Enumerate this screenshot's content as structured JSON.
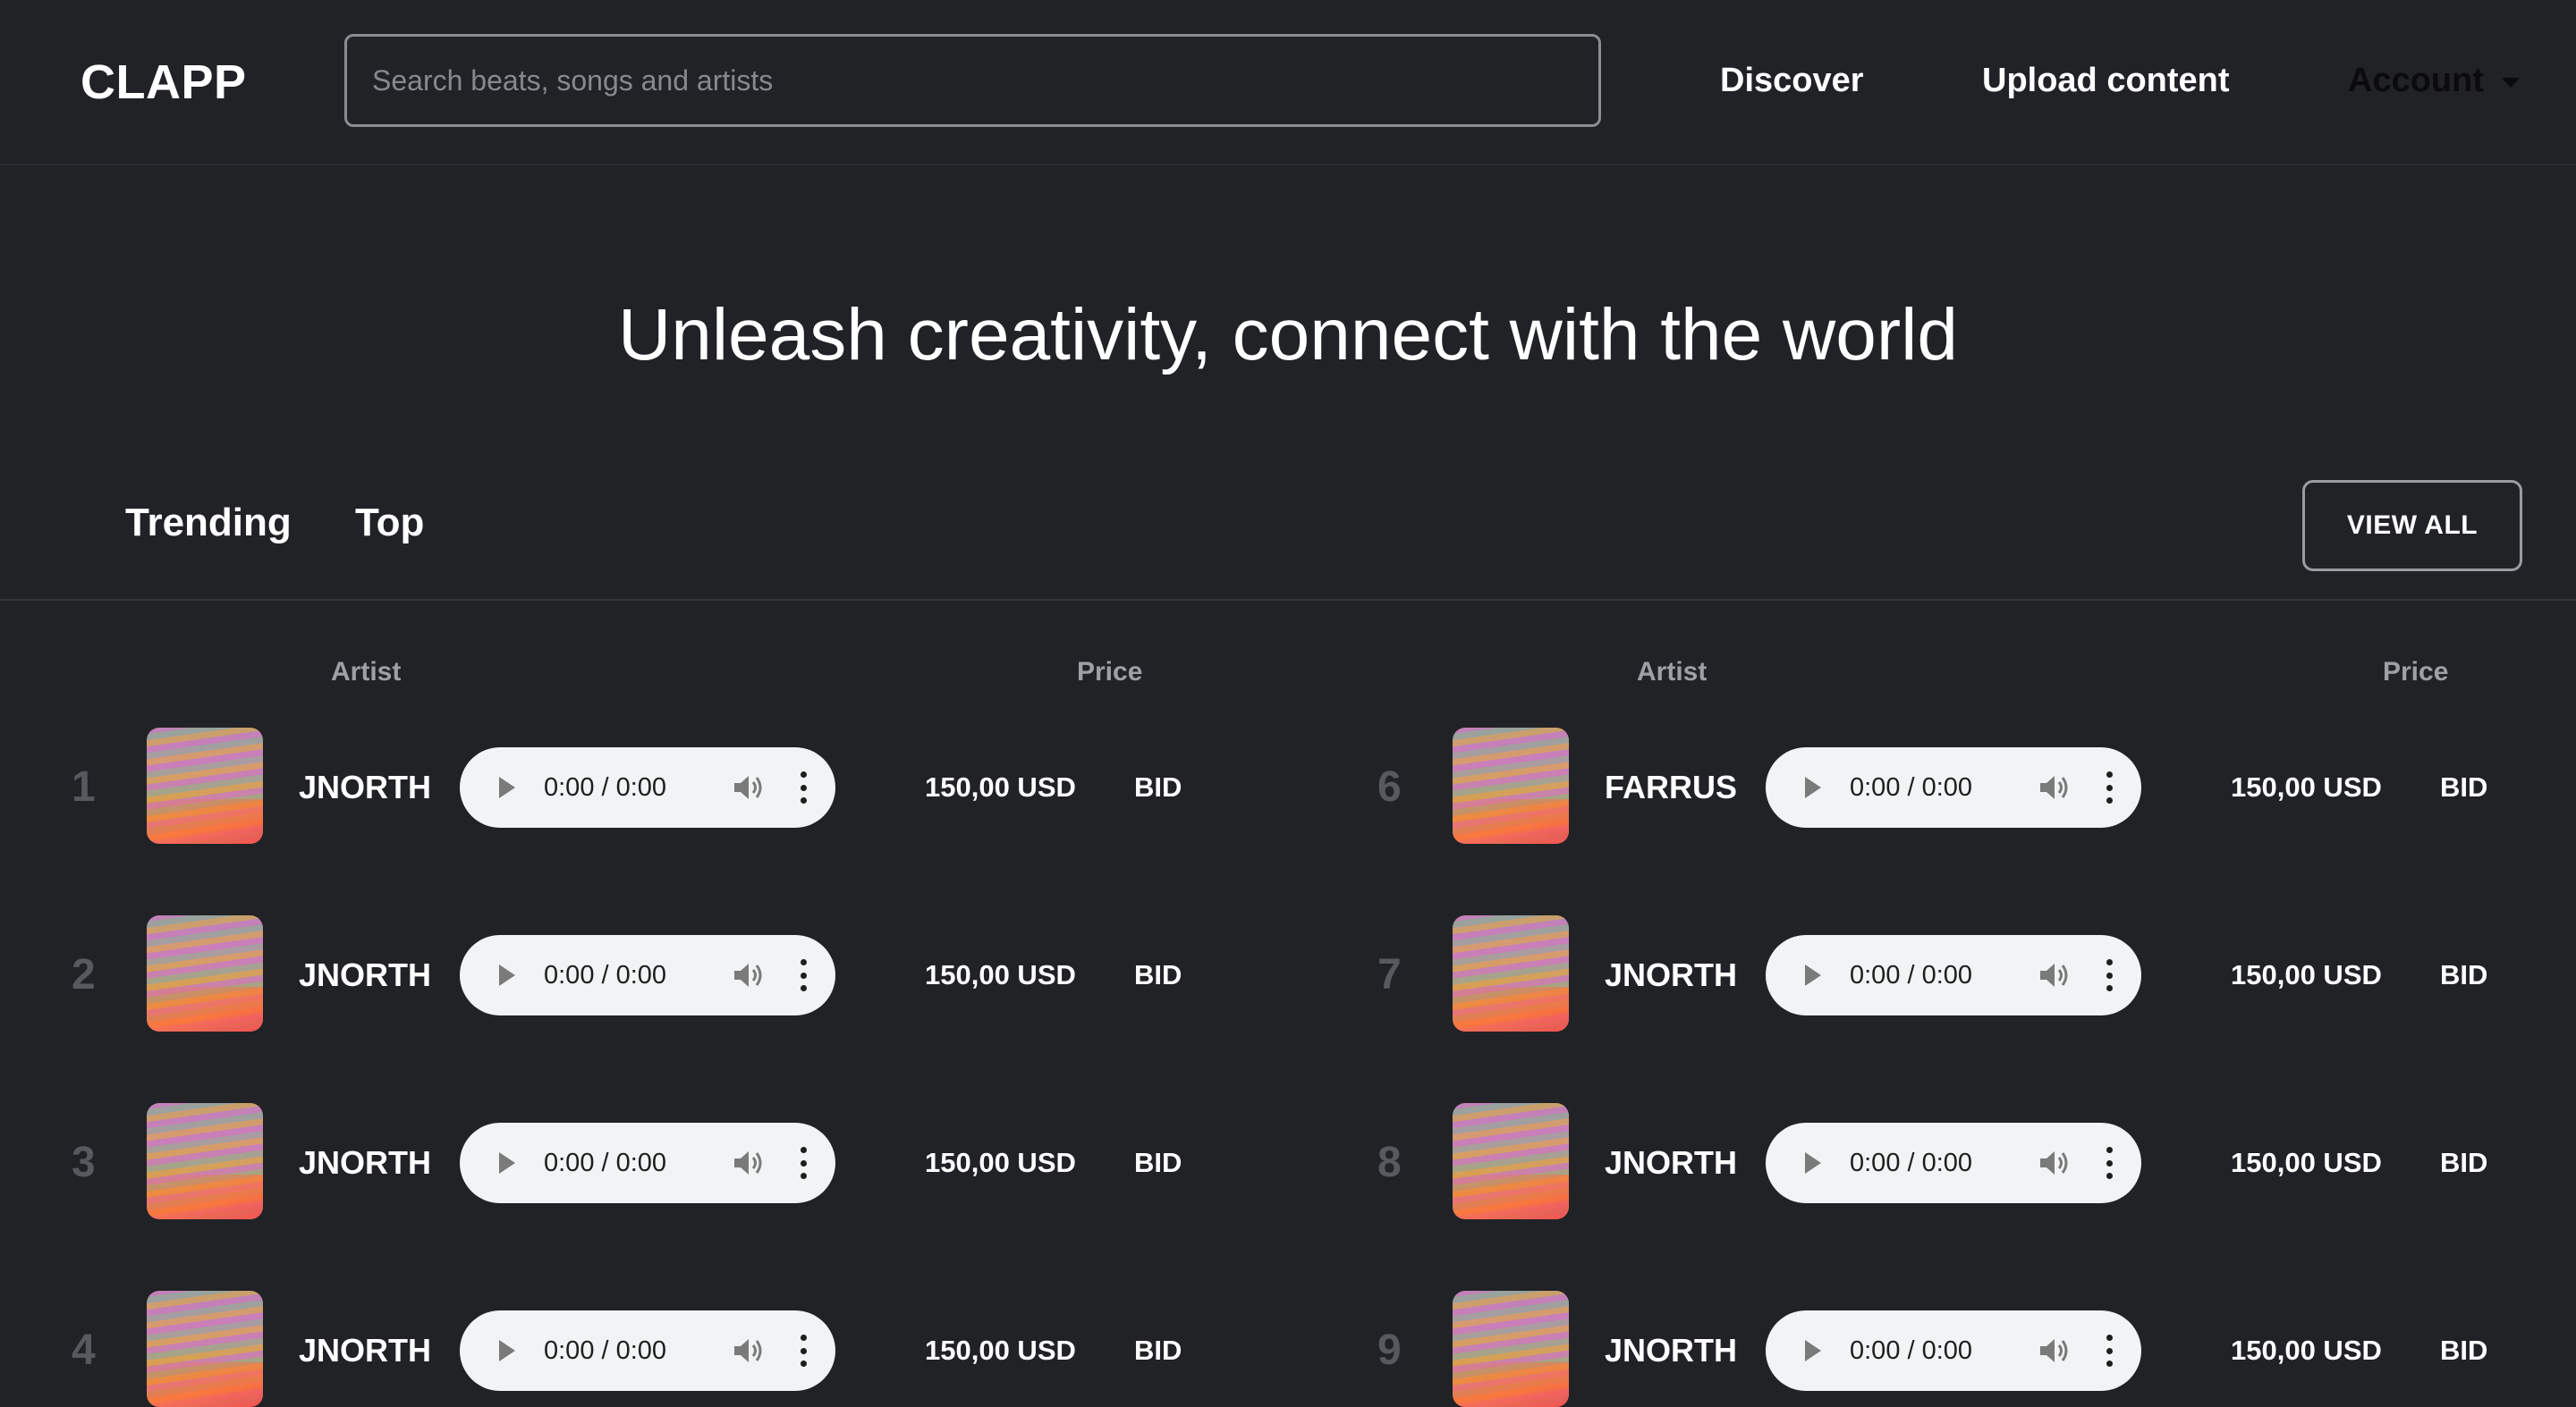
{
  "header": {
    "logo": "CLAPP",
    "search_placeholder": "Search beats, songs and artists",
    "nav": {
      "discover": "Discover",
      "upload": "Upload content",
      "account": "Account"
    }
  },
  "hero": {
    "title": "Unleash creativity, connect with the world"
  },
  "tabs": {
    "trending": "Trending",
    "top": "Top",
    "view_all": "VIEW ALL"
  },
  "table_headers": {
    "artist": "Artist",
    "price": "Price"
  },
  "colors": {
    "background": "#212226",
    "player": "#f1f3f4",
    "rank": "#57595f",
    "header_text": "#9ea0a6"
  },
  "columns": [
    {
      "rows": [
        {
          "rank": "1",
          "artist": "JNORTH",
          "time": "0:00 / 0:00",
          "price": "150,00 USD",
          "action": "BID"
        },
        {
          "rank": "2",
          "artist": "JNORTH",
          "time": "0:00 / 0:00",
          "price": "150,00 USD",
          "action": "BID"
        },
        {
          "rank": "3",
          "artist": "JNORTH",
          "time": "0:00 / 0:00",
          "price": "150,00 USD",
          "action": "BID"
        },
        {
          "rank": "4",
          "artist": "JNORTH",
          "time": "0:00 / 0:00",
          "price": "150,00 USD",
          "action": "BID"
        }
      ]
    },
    {
      "rows": [
        {
          "rank": "6",
          "artist": "FARRUS",
          "time": "0:00 / 0:00",
          "price": "150,00 USD",
          "action": "BID"
        },
        {
          "rank": "7",
          "artist": "JNORTH",
          "time": "0:00 / 0:00",
          "price": "150,00 USD",
          "action": "BID"
        },
        {
          "rank": "8",
          "artist": "JNORTH",
          "time": "0:00 / 0:00",
          "price": "150,00 USD",
          "action": "BID"
        },
        {
          "rank": "9",
          "artist": "JNORTH",
          "time": "0:00 / 0:00",
          "price": "150,00 USD",
          "action": "BID"
        }
      ]
    }
  ]
}
